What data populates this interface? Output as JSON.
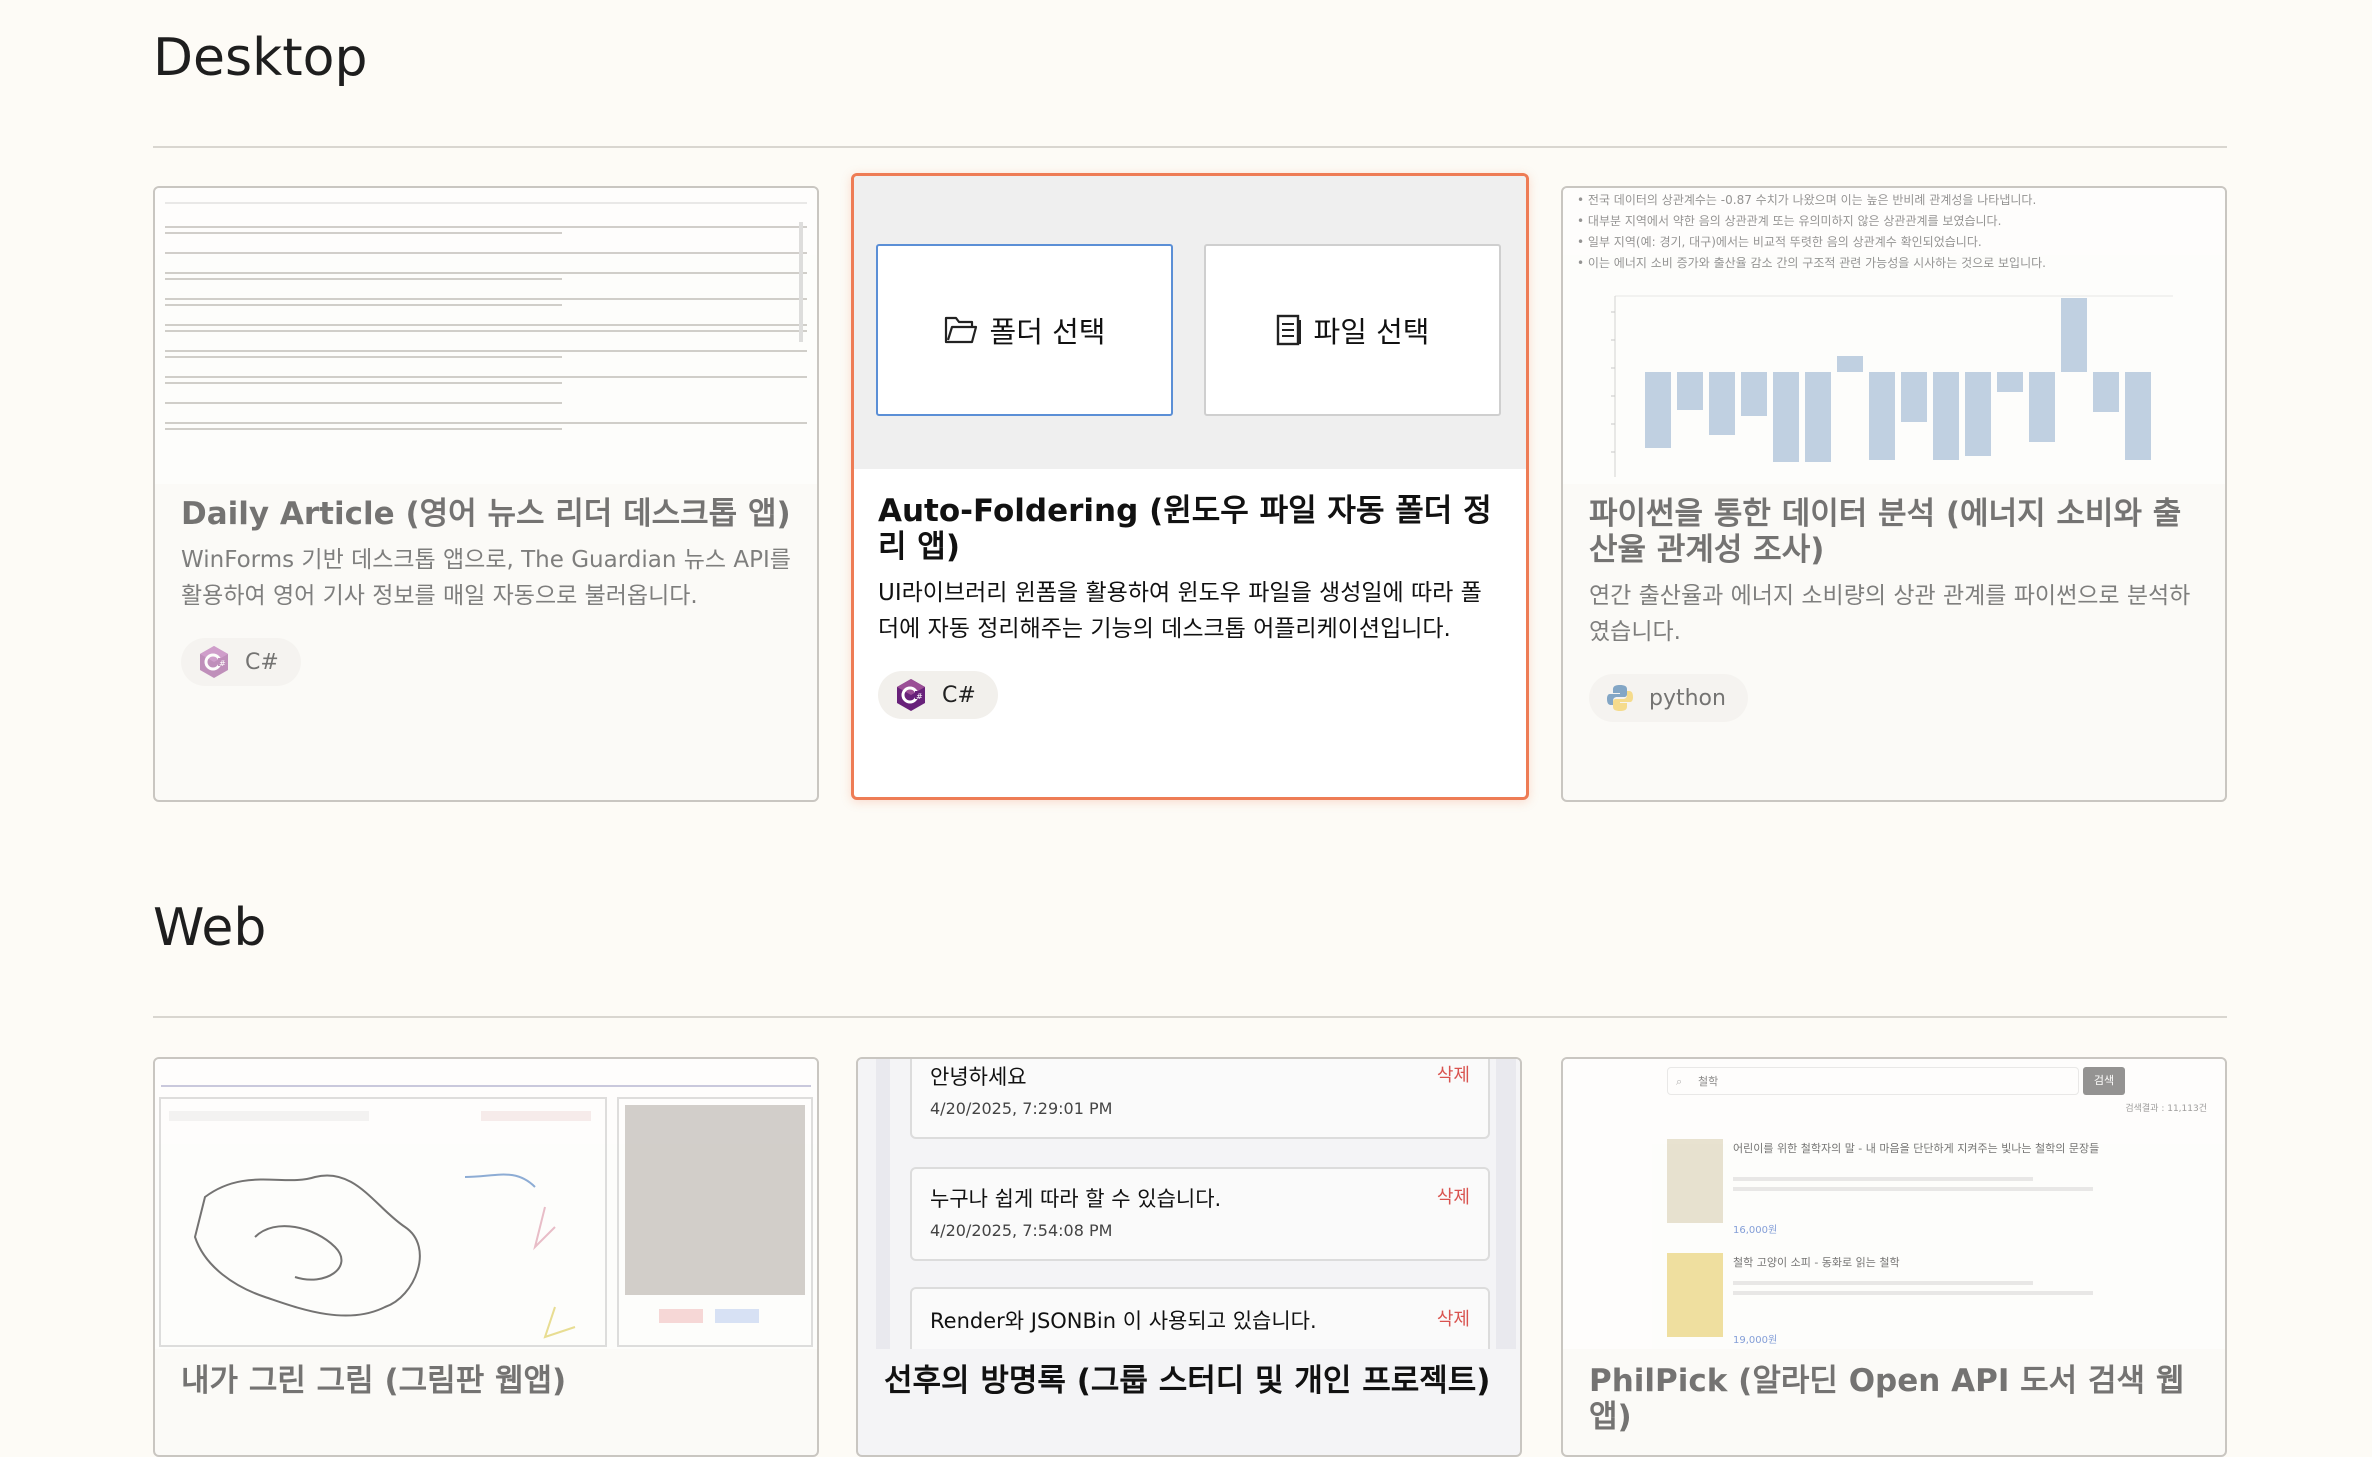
{
  "sections": {
    "desktop": {
      "title": "Desktop"
    },
    "web": {
      "title": "Web"
    }
  },
  "desktop_cards": [
    {
      "title": "Daily Article (영어 뉴스 리더 데스크톱 앱)",
      "desc": "WinForms 기반 데스크톱 앱으로, The Guardian 뉴스 API를 활용하여 영어 기사 정보를 매일 자동으로 불러옵니다.",
      "tag": "C#",
      "tag_icon": "csharp-icon"
    },
    {
      "title": "Auto-Foldering (윈도우 파일 자동 폴더 정리 앱)",
      "desc": "UI라이브러리 윈폼을 활용하여 윈도우 파일을 생성일에 따라 폴더에 자동 정리해주는 기능의 데스크톱 어플리케이션입니다.",
      "tag": "C#",
      "tag_icon": "csharp-icon",
      "thumb": {
        "folder_button": "폴더 선택",
        "file_button": "파일 선택"
      }
    },
    {
      "title": "파이썬을 통한 데이터 분석 (에너지 소비와 출산율 관계성 조사)",
      "desc": "연간 출산율과 에너지 소비량의 상관 관계를 파이썬으로 분석하였습니다.",
      "tag": "python",
      "tag_icon": "python-icon",
      "thumb": {
        "bullets": [
          "전국 데이터의 상관계수는 -0.87 수치가 나왔으며 이는 높은 반비례 관계성을 나타냅니다.",
          "대부분 지역에서 약한 음의 상관관계 또는 유의미하지 않은 상관관계를 보였습니다.",
          "일부 지역(예: 경기, 대구)에서는 비교적 뚜렷한 음의 상관계수 확인되었습니다.",
          "이는 에너지 소비 증가와 출산율 감소 간의 구조적 관련 가능성을 시사하는 것으로 보입니다."
        ]
      }
    }
  ],
  "web_cards": [
    {
      "title": "내가 그린 그림 (그림판 웹앱)"
    },
    {
      "title": "선후의 방명록 (그룹 스터디 및 개인 프로젝트)",
      "thumb": {
        "entries": [
          {
            "text": "안녕하세요",
            "date": "4/20/2025, 7:29:01 PM",
            "delete": "삭제"
          },
          {
            "text": "누구나 쉽게 따라 할 수 있습니다.",
            "date": "4/20/2025, 7:54:08 PM",
            "delete": "삭제"
          },
          {
            "text": "Render와 JSONBin 이 사용되고 있습니다.",
            "date": "",
            "delete": "삭제"
          }
        ]
      }
    },
    {
      "title": "PhilPick (알라딘 Open API 도서 검색 웹 앱)",
      "thumb": {
        "search_value": "철학",
        "search_button": "검색",
        "result_count": "검색결과 : 11,113건",
        "books": [
          {
            "title": "어린이를 위한 철학자의 말 - 내 마음을 단단하게 지켜주는 빛나는 철학의 문장들",
            "price": "16,000원"
          },
          {
            "title": "철학 고양이 소피 - 동화로 읽는 철학",
            "price": "19,000원"
          }
        ]
      }
    }
  ],
  "colors": {
    "accent": "#ee7c55",
    "bar": "#9db7d5",
    "delete": "#d9534f"
  }
}
